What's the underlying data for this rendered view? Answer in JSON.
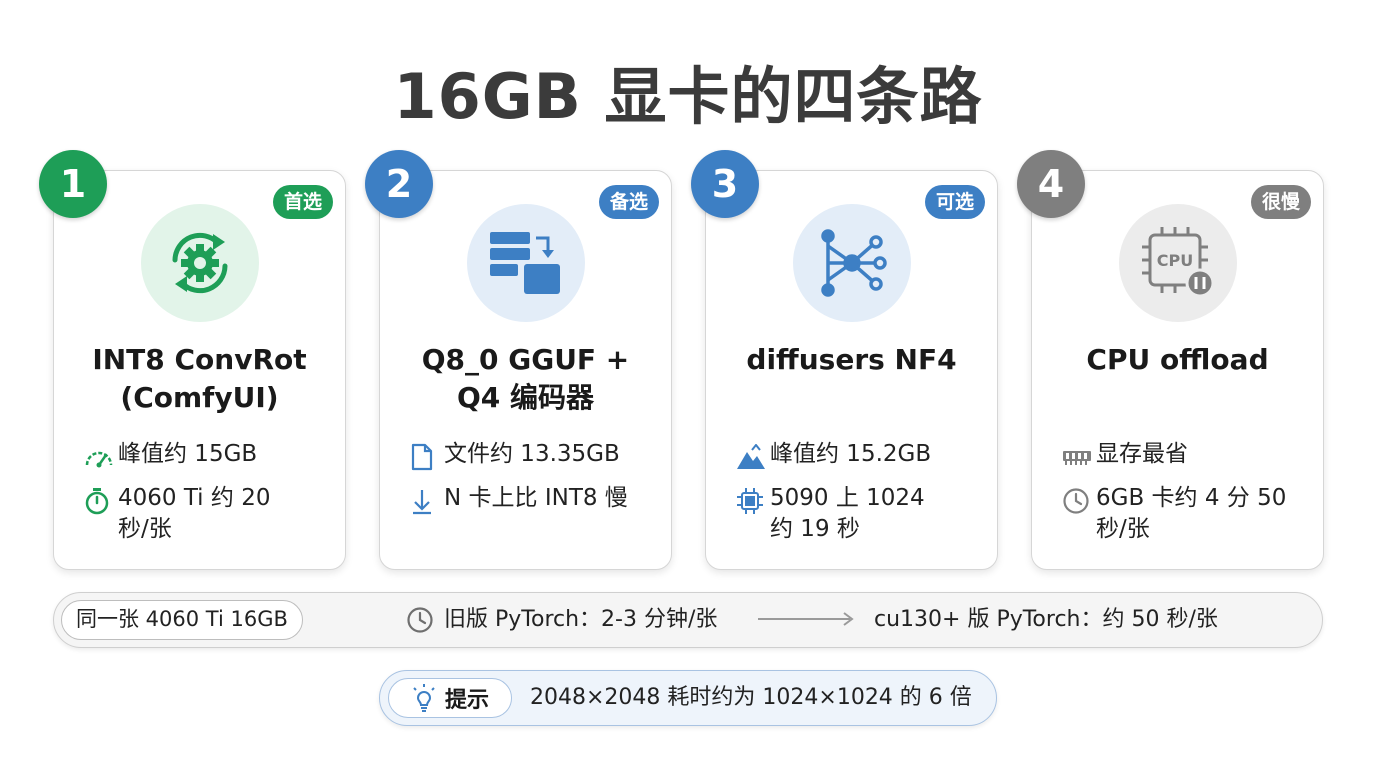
{
  "title": "16GB 显卡的四条路",
  "colors": {
    "green": "#1e9e57",
    "blue": "#3d7fc4",
    "gray": "#7f7f7f",
    "green_bg": "#e2f4e9",
    "blue_bg": "#e3edf8",
    "gray_bg": "#ececec"
  },
  "cards": [
    {
      "number": "1",
      "badge": "首选",
      "icon": "gear-sync-icon",
      "title_line1": "INT8 ConvRot",
      "title_line2": "(ComfyUI)",
      "features": [
        {
          "icon": "speedometer-icon",
          "lines": [
            "峰值约 15GB"
          ]
        },
        {
          "icon": "stopwatch-icon",
          "lines": [
            "4060 Ti 约 20",
            "秒/张"
          ]
        }
      ]
    },
    {
      "number": "2",
      "badge": "备选",
      "icon": "stack-compress-icon",
      "title_line1": "Q8_0 GGUF +",
      "title_line2": "Q4 编码器",
      "features": [
        {
          "icon": "file-icon",
          "lines": [
            "文件约 13.35GB"
          ]
        },
        {
          "icon": "arrow-down-icon",
          "lines": [
            "N 卡上比 INT8 慢"
          ]
        }
      ]
    },
    {
      "number": "3",
      "badge": "可选",
      "icon": "network-nodes-icon",
      "title_line1": "diffusers NF4",
      "title_line2": "",
      "features": [
        {
          "icon": "mountain-peak-icon",
          "lines": [
            "峰值约 15.2GB"
          ]
        },
        {
          "icon": "chip-icon",
          "lines": [
            "5090 上 1024",
            "约 19 秒"
          ]
        }
      ]
    },
    {
      "number": "4",
      "badge": "很慢",
      "icon": "cpu-pause-icon",
      "cpu_label": "CPU",
      "title_line1": "CPU offload",
      "title_line2": "",
      "features": [
        {
          "icon": "memory-stick-icon",
          "lines": [
            "显存最省"
          ]
        },
        {
          "icon": "clock-icon",
          "lines": [
            "6GB 卡约 4 分 50",
            "秒/张"
          ]
        }
      ]
    }
  ],
  "compare": {
    "label": "同一张 4060 Ti 16GB",
    "old": "旧版 PyTorch：2-3 分钟/张",
    "new": "cu130+ 版 PyTorch：约 50 秒/张"
  },
  "tip": {
    "label": "提示",
    "text": "2048×2048 耗时约为 1024×1024 的 6 倍"
  }
}
